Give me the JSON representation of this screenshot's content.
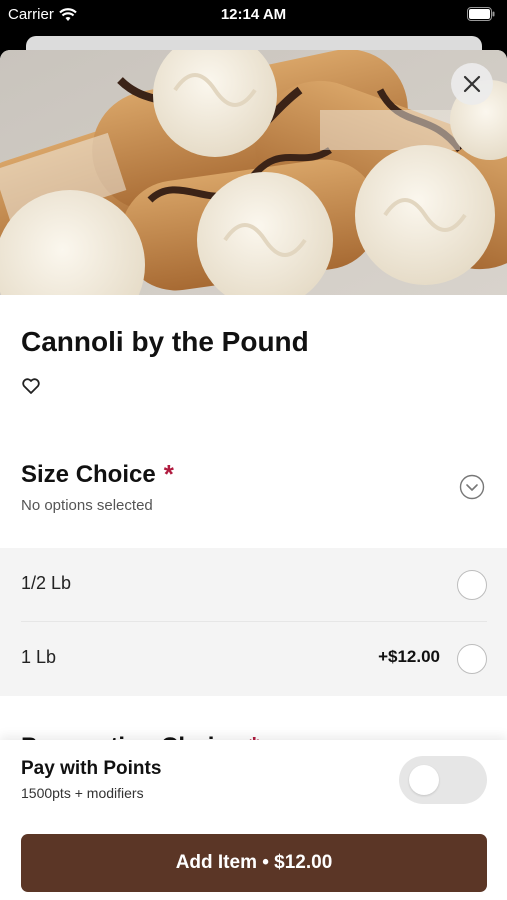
{
  "status_bar": {
    "carrier": "Carrier",
    "time": "12:14 AM",
    "wifi_icon": "wifi-icon",
    "battery_icon": "battery-icon"
  },
  "item": {
    "title": "Cannoli by the Pound",
    "favorite_icon": "heart-outline-icon",
    "close_icon": "close-icon"
  },
  "size_choice": {
    "title": "Size Choice",
    "required_mark": "*",
    "subtitle": "No options selected",
    "options": [
      {
        "label": "1/2 Lb",
        "price": ""
      },
      {
        "label": "1 Lb",
        "price": "+$12.00"
      }
    ]
  },
  "preparation_choice": {
    "title": "Preparation Choice",
    "required_mark": "*"
  },
  "points": {
    "title": "Pay with Points",
    "subtitle": "1500pts + modifiers",
    "enabled": false
  },
  "add_button": {
    "label": "Add Item • $12.00"
  },
  "colors": {
    "accent": "#5b3626",
    "required": "#b01b3f"
  }
}
